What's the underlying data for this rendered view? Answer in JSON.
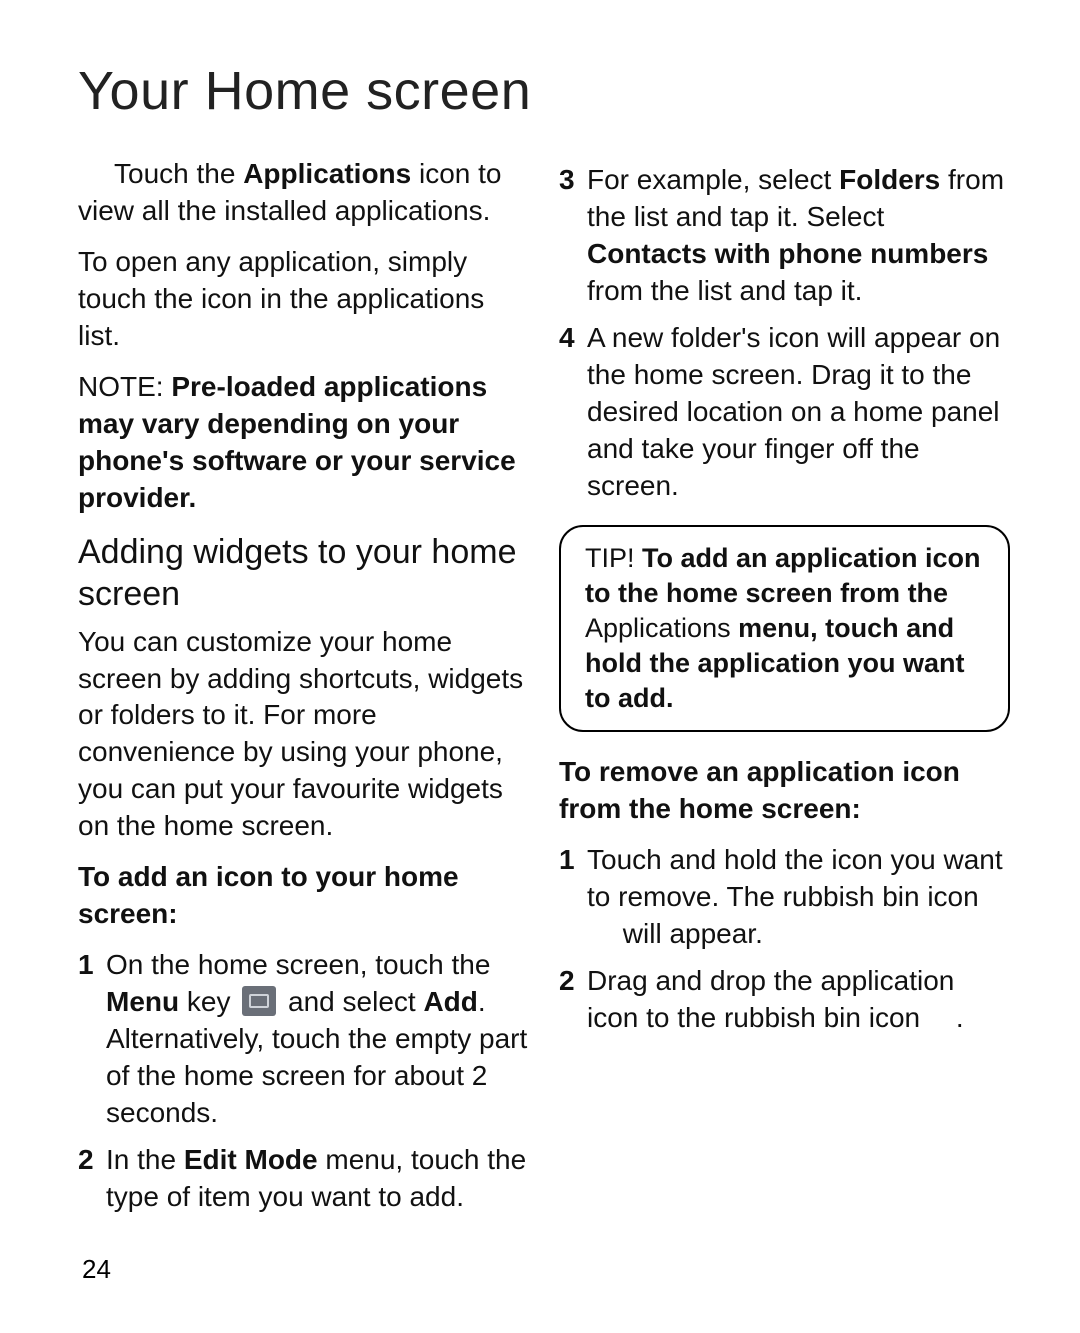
{
  "title": "Your Home screen",
  "pageNumber": "24",
  "left": {
    "intro1_prefix": "Touch the ",
    "intro1_bold": "Applications",
    "intro1_suffix": " icon to view all the installed applications.",
    "intro2": "To open any application, simply touch the icon in the applications list.",
    "note_label": "NOTE: ",
    "note_text": "Pre-loaded applications may vary depending on your phone's software or your service provider.",
    "subhead": "Adding widgets to your home screen",
    "para": "You can customize your home screen by adding shortcuts, widgets or folders to it. For more convenience by using your phone, you can put your favourite widgets on the home screen.",
    "addHeading": "To add an icon to your home screen:",
    "step1_a": "On the home screen, touch the ",
    "step1_menu": "Menu",
    "step1_b": " key ",
    "step1_c": " and select ",
    "step1_add": "Add",
    "step1_d": ". Alternatively, touch the empty part of the home screen for about 2 seconds.",
    "step2_a": "In the ",
    "step2_edit": "Edit Mode",
    "step2_b": " menu, touch the type of item you want to add."
  },
  "right": {
    "step3_a": "For example, select ",
    "step3_folders": "Folders",
    "step3_b": " from the list and tap it. Select ",
    "step3_contacts": "Contacts with phone numbers",
    "step3_c": " from the list and tap it.",
    "step4": "A new folder's icon will appear on the home screen. Drag it to the desired location on a home panel and take your finger off the screen.",
    "tip_label": "TIP!",
    "tip_bold_a": " To add an application icon to the home screen from the ",
    "tip_apps": "Applications",
    "tip_bold_b": " menu, touch and hold the application you want to add.",
    "removeHeading": "To remove an application icon from the home screen:",
    "rstep1": "Touch and hold the icon you want to remove. The rubbish bin icon ",
    "rstep1_b": " will appear.",
    "rstep2": "Drag and drop the application icon to the rubbish bin icon ",
    "rstep2_b": "."
  }
}
